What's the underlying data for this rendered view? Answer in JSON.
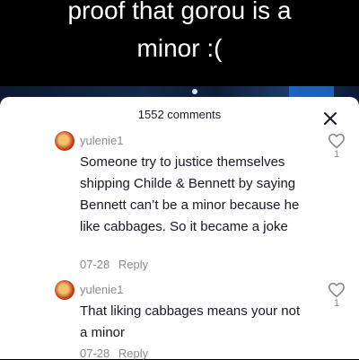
{
  "caption": {
    "line1": "proof that gorou is a",
    "line2": "minor :("
  },
  "comments_panel": {
    "count_label": "1552 comments",
    "close_icon": "close-icon",
    "comments": [
      {
        "username": "yulenie1",
        "text": "Someone try to justice themselves shipping Childe & Bennett by saying Bennett can’t be a minor because he like cabbages. So it became a joke",
        "date": "07-28",
        "reply_label": "Reply",
        "likes": "1",
        "like_icon": "heart-outline-icon"
      },
      {
        "username": "yulenie1",
        "text": "That liking cabbages means your not a minor",
        "date": "07-28",
        "reply_label": "Reply",
        "likes": "1",
        "like_icon": "heart-outline-icon"
      }
    ]
  }
}
